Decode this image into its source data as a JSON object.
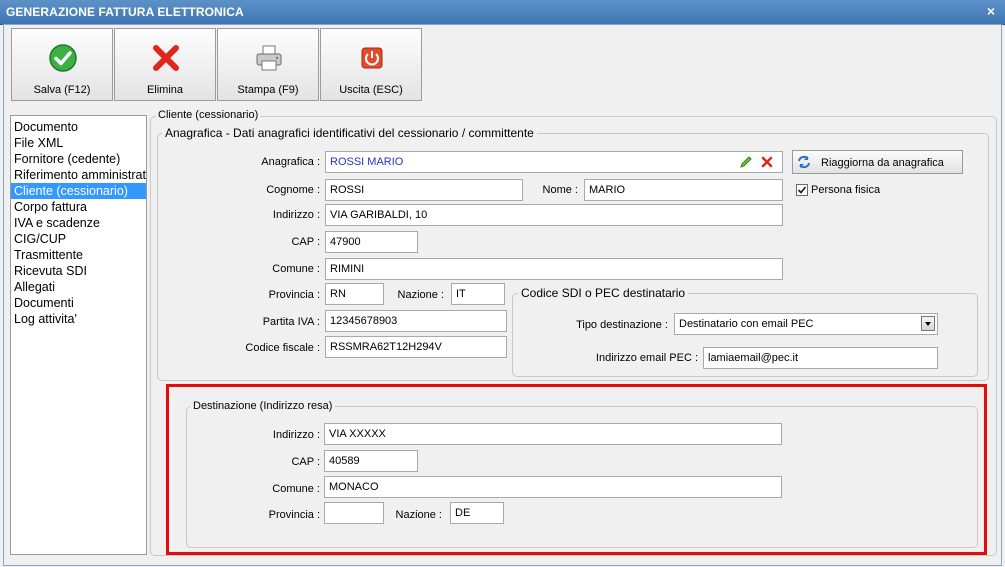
{
  "window": {
    "title": "GENERAZIONE FATTURA ELETTRONICA",
    "close": "×"
  },
  "toolbar": {
    "save_label": "Salva (F12)",
    "delete_label": "Elimina",
    "print_label": "Stampa (F9)",
    "exit_label": "Uscita (ESC)"
  },
  "nav": {
    "items": [
      {
        "label": "Documento"
      },
      {
        "label": "File XML"
      },
      {
        "label": "Fornitore (cedente)"
      },
      {
        "label": "Riferimento amministrativo"
      },
      {
        "label": "Cliente (cessionario)",
        "selected": true
      },
      {
        "label": "Corpo fattura"
      },
      {
        "label": "IVA e scadenze"
      },
      {
        "label": "CIG/CUP"
      },
      {
        "label": "Trasmittente"
      },
      {
        "label": "Ricevuta SDI"
      },
      {
        "label": "Allegati"
      },
      {
        "label": "Documenti"
      },
      {
        "label": "Log attivita'"
      }
    ]
  },
  "panel": {
    "title": "Cliente (cessionario)",
    "anagrafica_group": "Anagrafica - Dati anagrafici identificativi del cessionario / committente",
    "fields": {
      "anagrafica": {
        "label": "Anagrafica :",
        "value": "ROSSI MARIO"
      },
      "cognome": {
        "label": "Cognome :",
        "value": "ROSSI"
      },
      "nome": {
        "label": "Nome :",
        "value": "MARIO"
      },
      "indirizzo": {
        "label": "Indirizzo :",
        "value": "VIA GARIBALDI, 10"
      },
      "cap": {
        "label": "CAP :",
        "value": "47900"
      },
      "comune": {
        "label": "Comune :",
        "value": "RIMINI"
      },
      "provincia": {
        "label": "Provincia :",
        "value": "RN"
      },
      "nazione": {
        "label": "Nazione :",
        "value": "IT"
      },
      "partita_iva": {
        "label": "Partita IVA :",
        "value": "12345678903"
      },
      "codice_fiscale": {
        "label": "Codice fiscale :",
        "value": "RSSMRA62T12H294V"
      }
    },
    "refresh_button": "Riaggiorna da anagrafica",
    "persona_fisica": {
      "label": "Persona fisica",
      "checked": true
    },
    "sdi_group": {
      "title": "Codice SDI o PEC destinatario",
      "tipo_label": "Tipo destinazione :",
      "tipo_value": "Destinatario con email PEC",
      "email_label": "Indirizzo email PEC :",
      "email_value": "lamiaemail@pec.it"
    },
    "destinazione": {
      "title": "Destinazione (Indirizzo resa)",
      "indirizzo": {
        "label": "Indirizzo :",
        "value": "VIA XXXXX"
      },
      "cap": {
        "label": "CAP :",
        "value": "40589"
      },
      "comune": {
        "label": "Comune :",
        "value": "MONACO"
      },
      "provincia": {
        "label": "Provincia :",
        "value": ""
      },
      "nazione": {
        "label": "Nazione :",
        "value": "DE"
      }
    }
  },
  "colors": {
    "highlight_border": "#e30b0b",
    "selection": "#3399ff",
    "titlebar": "#4a82bf"
  },
  "icons": [
    "checkmark-icon",
    "delete-x-icon",
    "printer-icon",
    "exit-power-icon",
    "edit-pencil-icon",
    "clear-x-icon",
    "refresh-icon",
    "dropdown-arrow-icon"
  ]
}
